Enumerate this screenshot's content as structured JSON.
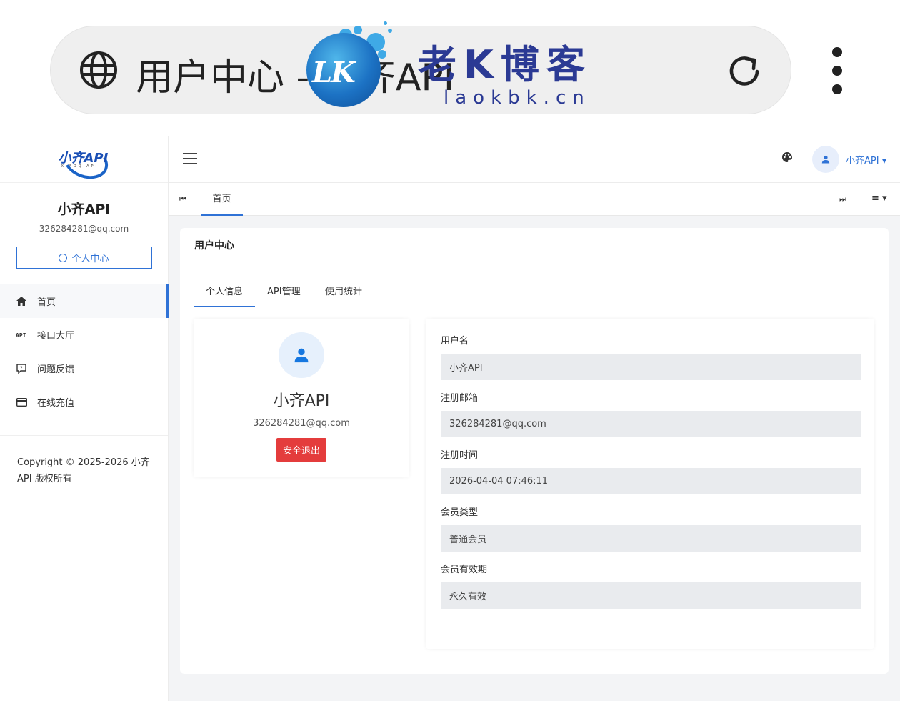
{
  "browser": {
    "url_title": "用户中心 - 小齐API",
    "watermark_title": "老K博客",
    "watermark_sub": "laokbk.cn",
    "watermark_mark": "LK"
  },
  "sidebar": {
    "logo_text": "小齐API",
    "logo_sub": "XIAOQIAPI",
    "user_name": "小齐API",
    "user_email": "326284281@qq.com",
    "center_button": "个人中心",
    "nav": [
      {
        "label": "首页",
        "icon": "home-icon"
      },
      {
        "label": "接口大厅",
        "icon": "api-icon"
      },
      {
        "label": "问题反馈",
        "icon": "feedback-icon"
      },
      {
        "label": "在线充值",
        "icon": "card-icon"
      }
    ],
    "copyright": "Copyright © 2025-2026 小齐API 版权所有"
  },
  "header": {
    "user_menu": "小齐API ▾"
  },
  "tabsbar": {
    "home_tab": "首页",
    "prev": "⏮",
    "next": "⏭",
    "menu": "≡ ▾"
  },
  "card": {
    "title": "用户中心",
    "tabs": [
      "个人信息",
      "API管理",
      "使用统计"
    ],
    "profile": {
      "name": "小齐API",
      "email": "326284281@qq.com",
      "logout": "安全退出"
    },
    "fields": [
      {
        "label": "用户名",
        "value": "小齐API"
      },
      {
        "label": "注册邮箱",
        "value": "326284281@qq.com"
      },
      {
        "label": "注册时间",
        "value": "2026-04-04 07:46:11"
      },
      {
        "label": "会员类型",
        "value": "普通会员"
      },
      {
        "label": "会员有效期",
        "value": "永久有效"
      }
    ]
  },
  "colors": {
    "accent": "#2f72d6",
    "danger": "#e43c3c",
    "watermark": "#2b3a94"
  }
}
